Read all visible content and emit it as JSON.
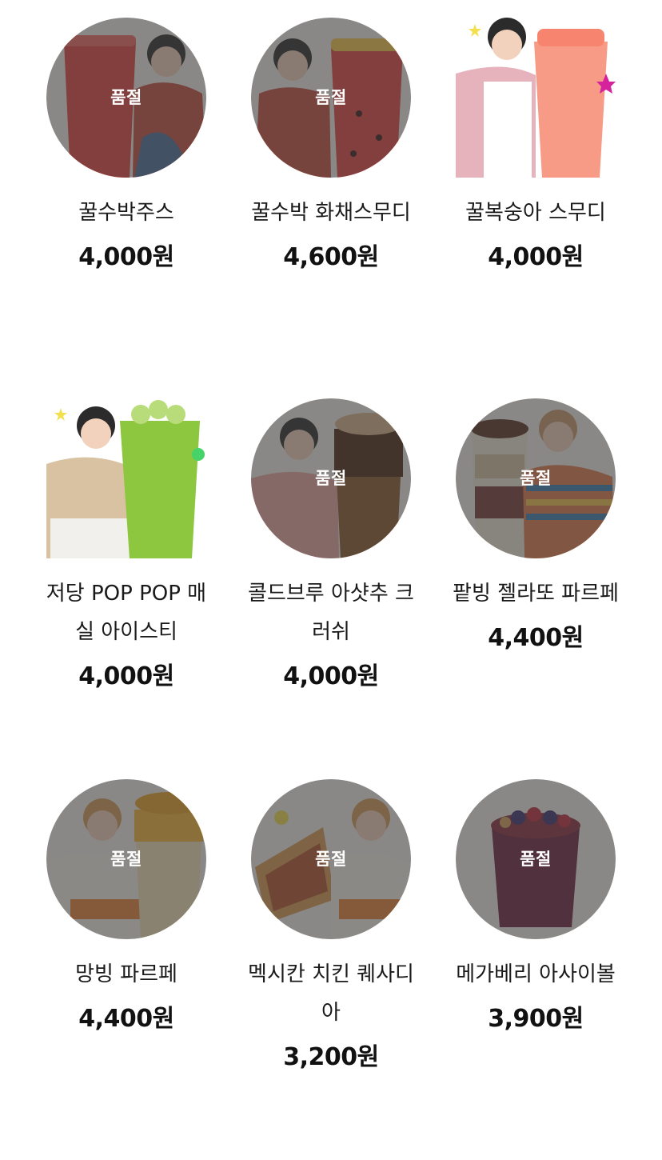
{
  "products": [
    {
      "name": "꿀수박주스",
      "price": "4,000원",
      "badge": "품절",
      "sold_out": true,
      "image": "watermelon-juice-image"
    },
    {
      "name": "꿀수박 화채스무디",
      "price": "4,600원",
      "badge": "품절",
      "sold_out": true,
      "image": "watermelon-punch-smoothie-image"
    },
    {
      "name": "꿀복숭아 스무디",
      "price": "4,000원",
      "badge": "",
      "sold_out": false,
      "image": "peach-smoothie-image"
    },
    {
      "name": "저당 POP POP 매실 아이스티",
      "price": "4,000원",
      "badge": "",
      "sold_out": false,
      "image": "plum-iced-tea-image"
    },
    {
      "name": "콜드브루 아샷추 크러쉬",
      "price": "4,000원",
      "badge": "품절",
      "sold_out": true,
      "image": "coldbrew-crush-image"
    },
    {
      "name": "팥빙 젤라또 파르페",
      "price": "4,400원",
      "badge": "품절",
      "sold_out": true,
      "image": "redbean-parfait-image"
    },
    {
      "name": "망빙 파르페",
      "price": "4,400원",
      "badge": "품절",
      "sold_out": true,
      "image": "mango-parfait-image"
    },
    {
      "name": "멕시칸 치킨 퀘사디아",
      "price": "3,200원",
      "badge": "품절",
      "sold_out": true,
      "image": "chicken-quesadilla-image"
    },
    {
      "name": "메가베리 아사이볼",
      "price": "3,900원",
      "badge": "품절",
      "sold_out": true,
      "image": "acai-bowl-image"
    }
  ],
  "colors": {
    "watermelon": "#e2433f",
    "peach": "#f79a86",
    "plum": "#8dc63f",
    "coldbrew": "#8a5a2e",
    "redbean": "#7b3b3b",
    "mango": "#f5b63a",
    "quesadilla": "#d99a52",
    "acai": "#6e2240",
    "soldout_overlay": "#3c3c3c"
  }
}
